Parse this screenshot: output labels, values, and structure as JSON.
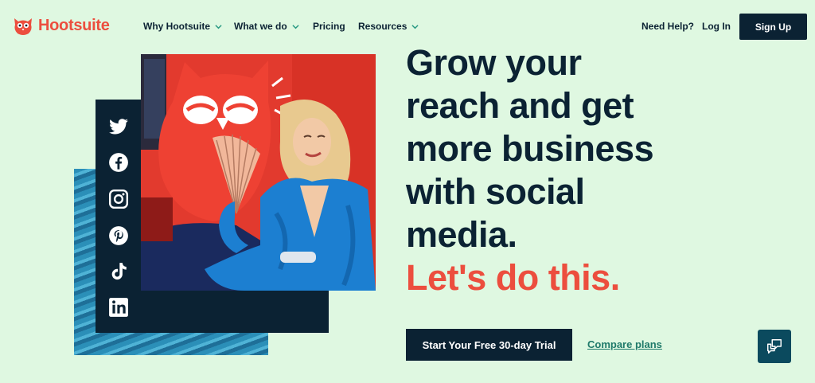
{
  "brand": {
    "name": "Hootsuite",
    "color": "#ec4e3e"
  },
  "nav": {
    "items": [
      {
        "label": "Why Hootsuite",
        "dropdown": true
      },
      {
        "label": "What we do",
        "dropdown": true
      },
      {
        "label": "Pricing",
        "dropdown": false
      },
      {
        "label": "Resources",
        "dropdown": true
      }
    ],
    "help": "Need Help?",
    "login": "Log In",
    "signup": "Sign Up"
  },
  "social_icons": [
    "twitter-icon",
    "facebook-icon",
    "instagram-icon",
    "pinterest-icon",
    "tiktok-icon",
    "linkedin-icon"
  ],
  "hero": {
    "headline_lines": [
      "Grow your",
      "reach and get",
      "more business",
      "with social",
      "media."
    ],
    "accent_line": "Let's do this.",
    "cta_primary": "Start Your Free 30-day Trial",
    "cta_secondary": "Compare plans"
  },
  "colors": {
    "background": "#dff8e1",
    "navy": "#0b2233",
    "accent": "#ec4e3e",
    "link": "#1f7a6a"
  }
}
